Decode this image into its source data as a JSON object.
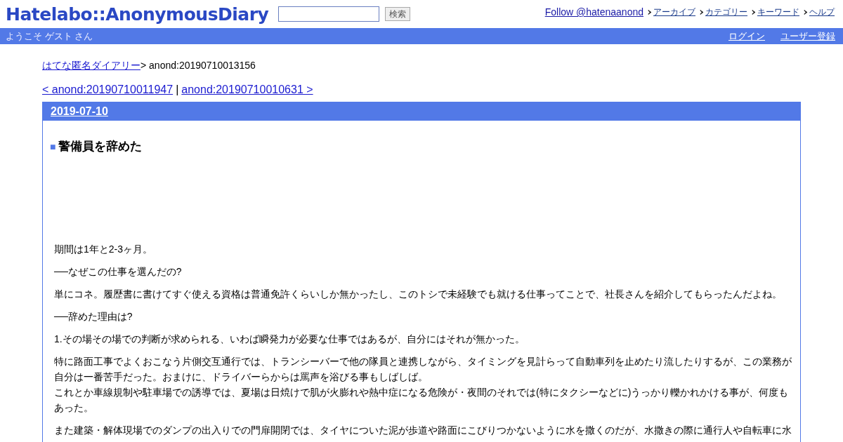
{
  "header": {
    "logo": "Hatelabo::AnonymousDiary",
    "search": {
      "button": "検索"
    },
    "follow_link": "Follow @hatenaanond",
    "nav": [
      "アーカイブ",
      "カテゴリー",
      "キーワード",
      "ヘルプ"
    ]
  },
  "user_bar": {
    "welcome": "ようこそ ゲスト さん",
    "links": [
      "ログイン",
      "ユーザー登録"
    ]
  },
  "breadcrumb": {
    "link": "はてな匿名ダイアリー",
    "current": "> anond:20190710013156"
  },
  "pager": {
    "prev": "< anond:20190710011947",
    "separator": "|",
    "next": "anond:20190710010631 >"
  },
  "day": {
    "date": "2019-07-10",
    "entry": {
      "mark": "■",
      "title": "警備員を辞めた",
      "paragraphs": [
        [
          "期間は1年と2-3ヶ月。"
        ],
        [
          "──なぜこの仕事を選んだの?"
        ],
        [
          "単にコネ。履歴書に書けてすぐ使える資格は普通免許くらいしか無かったし、このトシで未経験でも就ける仕事ってことで、社長さんを紹介してもらったんだよね。"
        ],
        [
          "──辞めた理由は?"
        ],
        [
          "1.その場その場での判断が求められる、いわば瞬発力が必要な仕事ではあるが、自分にはそれが無かった。"
        ],
        [
          "特に路面工事でよくおこなう片側交互通行では、トランシーバーで他の隊員と連携しながら、タイミングを見計らって自動車列を止めたり流したりするが、この業務が自分は一番苦手だった。おまけに、ドライバーらからは罵声を浴びる事もしばしば。",
          "これとか車線規制や駐車場での誘導では、夏場は日焼けで肌が火膨れや熱中症になる危険が・夜間のそれでは(特にタクシーなどに)うっかり轢かれかける事が、何度もあった。"
        ],
        [
          "また建築・解体現場でのダンプの出入りでの門扉開閉では、タイヤについた泥が歩道や路面にこびりつかないように水を撒くのだが、水撒きの際に通行人や自転車に水"
        ]
      ]
    }
  }
}
